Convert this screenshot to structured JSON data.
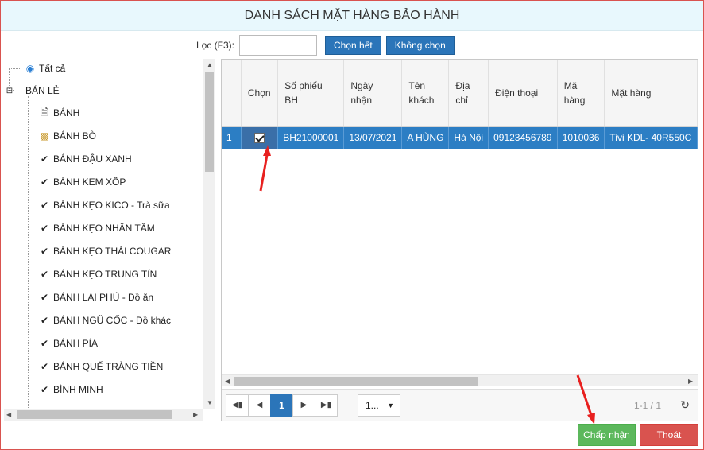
{
  "title": "DANH SÁCH MẶT HÀNG BẢO HÀNH",
  "filter": {
    "label": "Lọc (F3):",
    "value": "",
    "select_all": "Chọn hết",
    "select_none": "Không chọn"
  },
  "tree": {
    "root_all": "Tất cả",
    "group": "BÁN LẺ",
    "items": [
      "BÁNH",
      "BÁNH BÒ",
      "BÁNH ĐẬU XANH",
      "BÁNH KEM XỐP",
      "BÁNH KẸO KICO - Trà sữa",
      "BÁNH KẸO NHÂN TÂM",
      "BÁNH KẸO THÁI COUGAR",
      "BÁNH KẸO TRUNG TÍN",
      "BÁNH LAI PHÚ - Đồ ăn",
      "BÁNH NGŨ CỐC - Đồ khác",
      "BÁNH PÍA",
      "BÁNH QUẾ TRÀNG TIỀN",
      "BÌNH MINH"
    ]
  },
  "grid": {
    "headers": [
      "",
      "Chọn",
      "Số phiếu BH",
      "Ngày nhận",
      "Tên khách",
      "Địa chỉ",
      "Điện thoại",
      "Mã hàng",
      "Mặt hàng"
    ],
    "rows": [
      [
        "1",
        "",
        "BH21000001",
        "13/07/2021",
        "A HÙNG",
        "Hà Nội",
        "09123456789",
        "1010036",
        "Tivi KDL- 40R550C"
      ]
    ]
  },
  "pager": {
    "current_page": "1",
    "page_size": "1...",
    "info": "1-1 / 1"
  },
  "actions": {
    "accept": "Chấp nhận",
    "exit": "Thoát"
  },
  "colors": {
    "accent": "#2b75b9",
    "selected_row": "#2c7ec4",
    "accept": "#5cb85c",
    "exit": "#d9534f",
    "title_bg": "#e8f8fd"
  }
}
